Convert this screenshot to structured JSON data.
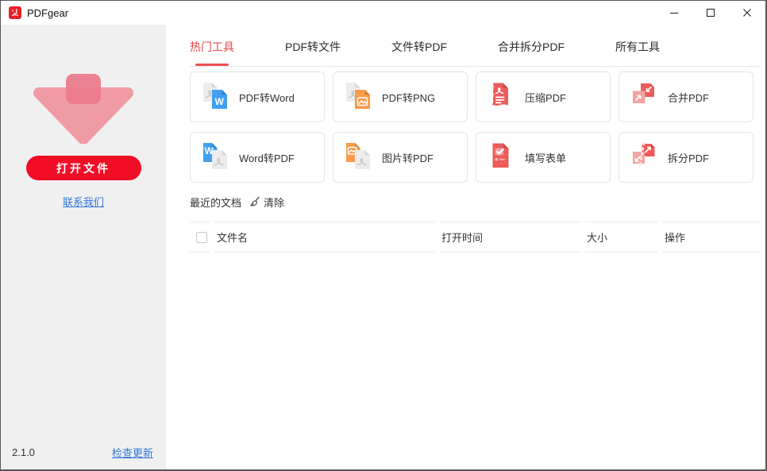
{
  "window": {
    "title": "PDFgear"
  },
  "colors": {
    "brand_red": "#e62129",
    "open_button_red": "#f20d26",
    "tab_active_red": "#e8474c",
    "link_blue": "#3077d8",
    "coral_icon": "#ed5a5a",
    "doc_blue": "#41a0ee",
    "doc_orange": "#f89b4b",
    "doc_gray": "#ececec",
    "sidebar_bg": "#f0f0f0"
  },
  "sidebar": {
    "open_button_label": "打开文件",
    "contact_link_label": "联系我们",
    "version": "2.1.0",
    "check_update_label": "检查更新"
  },
  "tabs": [
    {
      "label": "热门工具",
      "active": true
    },
    {
      "label": "PDF转文件",
      "active": false
    },
    {
      "label": "文件转PDF",
      "active": false
    },
    {
      "label": "合并拆分PDF",
      "active": false
    },
    {
      "label": "所有工具",
      "active": false
    }
  ],
  "tools": [
    {
      "label": "PDF转Word",
      "icon": "pdf-to-word-icon"
    },
    {
      "label": "PDF转PNG",
      "icon": "pdf-to-png-icon"
    },
    {
      "label": "压缩PDF",
      "icon": "compress-pdf-icon"
    },
    {
      "label": "合并PDF",
      "icon": "merge-pdf-icon"
    },
    {
      "label": "Word转PDF",
      "icon": "word-to-pdf-icon"
    },
    {
      "label": "图片转PDF",
      "icon": "image-to-pdf-icon"
    },
    {
      "label": "填写表单",
      "icon": "fill-form-icon"
    },
    {
      "label": "拆分PDF",
      "icon": "split-pdf-icon"
    }
  ],
  "recent": {
    "title": "最近的文档",
    "clear_label": "清除"
  },
  "table": {
    "headers": [
      "文件名",
      "打开时间",
      "大小",
      "操作"
    ],
    "rows": []
  }
}
